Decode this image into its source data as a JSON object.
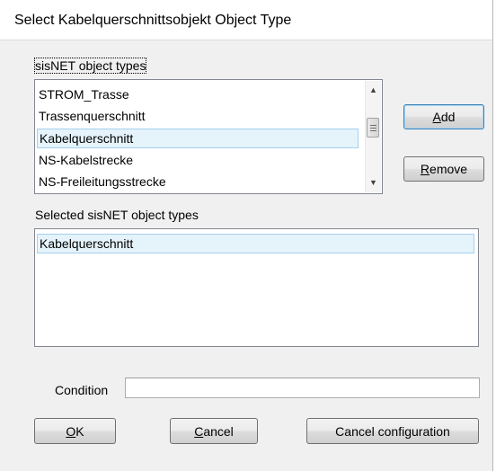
{
  "window": {
    "title": "Select Kabelquerschnittsobjekt Object Type"
  },
  "available": {
    "label": "sisNET object types",
    "items": [
      {
        "label": "STROM_Trasse",
        "selected": false
      },
      {
        "label": "Trassenquerschnitt",
        "selected": false
      },
      {
        "label": "Kabelquerschnitt",
        "selected": true
      },
      {
        "label": "NS-Kabelstrecke",
        "selected": false
      },
      {
        "label": "NS-Freileitungsstrecke",
        "selected": false
      }
    ]
  },
  "selected_list": {
    "label": "Selected sisNET object types",
    "items": [
      {
        "label": "Kabelquerschnitt",
        "selected": true
      }
    ]
  },
  "buttons": {
    "add": {
      "mnemonic": "A",
      "rest": "dd"
    },
    "remove": {
      "mnemonic": "R",
      "rest": "emove"
    },
    "ok": {
      "mnemonic": "O",
      "rest": "K"
    },
    "cancel": {
      "mnemonic": "C",
      "rest": "ancel"
    },
    "cancel_configuration": "Cancel configuration"
  },
  "condition": {
    "label": "Condition",
    "value": ""
  },
  "colors": {
    "dialog_bg": "#f0f0f0",
    "selection_bg": "#e5f3fb",
    "selection_border": "#a6d0ee",
    "default_button_border": "#3c7fb1"
  },
  "icons": {
    "scroll_up": "triangle-up",
    "scroll_down": "triangle-down",
    "scroll_thumb_grip": "three-lines"
  }
}
